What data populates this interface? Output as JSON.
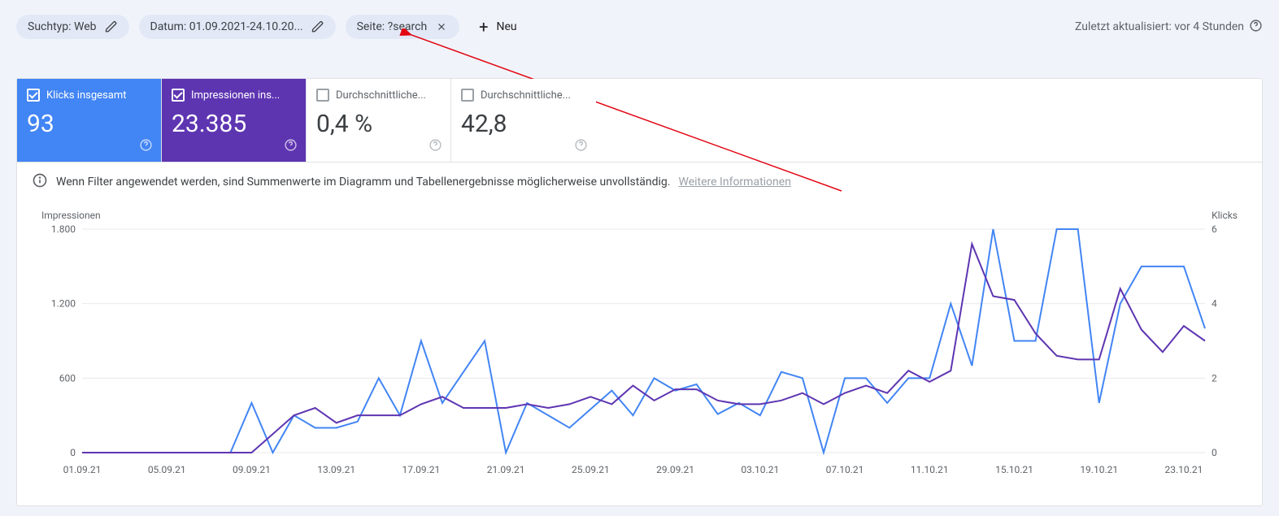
{
  "filters": {
    "search_type": "Suchtyp: Web",
    "date": "Datum: 01.09.2021-24.10.20...",
    "page": "Seite: ?search",
    "new": "Neu"
  },
  "updated": "Zuletzt aktualisiert: vor 4 Stunden",
  "metrics": {
    "clicks": {
      "label": "Klicks insgesamt",
      "value": "93"
    },
    "impressions": {
      "label": "Impressionen ins...",
      "value": "23.385"
    },
    "ctr": {
      "label": "Durchschnittliche...",
      "value": "0,4 %"
    },
    "position": {
      "label": "Durchschnittliche...",
      "value": "42,8"
    }
  },
  "info": {
    "text": "Wenn Filter angewendet werden, sind Summenwerte im Diagramm und Tabellenergebnisse möglicherweise unvollständig.",
    "link": "Weitere Informationen"
  },
  "chart_data": {
    "type": "line",
    "xlabel": "",
    "ylabel_left": "Impressionen",
    "ylabel_right": "Klicks",
    "ylim_left": [
      0,
      1800
    ],
    "ylim_right": [
      0,
      6
    ],
    "left_ticks": [
      "0",
      "600",
      "1.200",
      "1.800"
    ],
    "right_ticks": [
      "0",
      "2",
      "4",
      "6"
    ],
    "x_major_labels": [
      "01.09.21",
      "05.09.21",
      "09.09.21",
      "13.09.21",
      "17.09.21",
      "21.09.21",
      "25.09.21",
      "29.09.21",
      "03.10.21",
      "07.10.21",
      "11.10.21",
      "15.10.21",
      "19.10.21",
      "23.10.21"
    ],
    "categories": [
      "01.09.21",
      "02.09.21",
      "03.09.21",
      "04.09.21",
      "05.09.21",
      "06.09.21",
      "07.09.21",
      "08.09.21",
      "09.09.21",
      "10.09.21",
      "11.09.21",
      "12.09.21",
      "13.09.21",
      "14.09.21",
      "15.09.21",
      "16.09.21",
      "17.09.21",
      "18.09.21",
      "19.09.21",
      "20.09.21",
      "21.09.21",
      "22.09.21",
      "23.09.21",
      "24.09.21",
      "25.09.21",
      "26.09.21",
      "27.09.21",
      "28.09.21",
      "29.09.21",
      "30.09.21",
      "01.10.21",
      "02.10.21",
      "03.10.21",
      "04.10.21",
      "05.10.21",
      "06.10.21",
      "07.10.21",
      "08.10.21",
      "09.10.21",
      "10.10.21",
      "11.10.21",
      "12.10.21",
      "13.10.21",
      "14.10.21",
      "15.10.21",
      "16.10.21",
      "17.10.21",
      "18.10.21",
      "19.10.21",
      "20.10.21",
      "21.10.21",
      "22.10.21",
      "23.10.21",
      "24.10.21"
    ],
    "series": [
      {
        "name": "Impressionen",
        "axis": "left",
        "color": "#4285f4",
        "values": [
          0,
          0,
          0,
          0,
          0,
          0,
          0,
          0,
          400,
          0,
          300,
          200,
          200,
          250,
          600,
          300,
          900,
          400,
          650,
          900,
          0,
          400,
          300,
          200,
          350,
          500,
          300,
          600,
          500,
          550,
          310,
          400,
          300,
          650,
          600,
          0,
          600,
          600,
          400,
          600,
          600,
          1200,
          700,
          1800,
          900,
          900,
          1800,
          1800,
          400,
          1200,
          1500,
          1500,
          1500,
          1000
        ]
      },
      {
        "name": "Klicks",
        "axis": "right",
        "color": "#5e35b1",
        "values": [
          0,
          0,
          0,
          0,
          0,
          0,
          0,
          0,
          0,
          0.5,
          1,
          1.2,
          0.8,
          1,
          1,
          1,
          1.3,
          1.5,
          1.2,
          1.2,
          1.2,
          1.3,
          1.2,
          1.3,
          1.5,
          1.3,
          1.8,
          1.4,
          1.7,
          1.7,
          1.4,
          1.3,
          1.3,
          1.4,
          1.6,
          1.3,
          1.6,
          1.8,
          1.6,
          2.2,
          1.9,
          2.2,
          5.6,
          4.2,
          4.1,
          3.2,
          2.6,
          2.5,
          2.5,
          4.4,
          3.3,
          2.7,
          3.4,
          3.0
        ]
      }
    ]
  }
}
